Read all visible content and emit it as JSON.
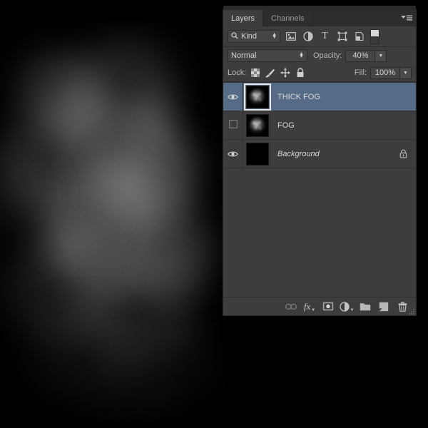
{
  "panel": {
    "tabs": [
      {
        "label": "Layers",
        "active": true
      },
      {
        "label": "Channels",
        "active": false
      }
    ],
    "menu_icon": "panel-menu-icon"
  },
  "filter": {
    "kind_label": "Kind",
    "search_icon": "search-icon",
    "icons": [
      "pixel-layer-filter-icon",
      "adjustment-layer-filter-icon",
      "type-layer-filter-icon",
      "shape-layer-filter-icon",
      "smart-object-filter-icon"
    ],
    "toggle_icon": "filter-enable-toggle"
  },
  "blend": {
    "mode": "Normal",
    "opacity_label": "Opacity:",
    "opacity_value": "40%"
  },
  "lock": {
    "label": "Lock:",
    "icons": [
      "lock-transparent-pixels-icon",
      "lock-image-pixels-icon",
      "lock-position-icon",
      "lock-all-icon"
    ],
    "fill_label": "Fill:",
    "fill_value": "100%"
  },
  "layers": [
    {
      "name": "THICK FOG",
      "visible": true,
      "selected": true,
      "italic": false,
      "locked": false,
      "thumbnail": "fog-thumbnail"
    },
    {
      "name": "FOG",
      "visible": false,
      "selected": false,
      "italic": false,
      "locked": false,
      "thumbnail": "fog-thumbnail"
    },
    {
      "name": "Background",
      "visible": true,
      "selected": false,
      "italic": true,
      "locked": true,
      "thumbnail": "black-thumbnail"
    }
  ],
  "bottom_bar": {
    "buttons": [
      {
        "name": "link-layers-icon",
        "label": ""
      },
      {
        "name": "layer-style-fx-icon",
        "label": "fx"
      },
      {
        "name": "add-layer-mask-icon",
        "label": ""
      },
      {
        "name": "new-adjustment-layer-icon",
        "label": ""
      },
      {
        "name": "new-group-icon",
        "label": ""
      },
      {
        "name": "new-layer-icon",
        "label": ""
      },
      {
        "name": "delete-layer-icon",
        "label": ""
      }
    ]
  },
  "colors": {
    "panel_bg": "#3d3d3d",
    "tab_bar_bg": "#2d2d2d",
    "selected_row": "#566b86",
    "text": "#d2d2d2",
    "canvas_bg": "#000000"
  },
  "canvas": {
    "description": "fog texture"
  }
}
